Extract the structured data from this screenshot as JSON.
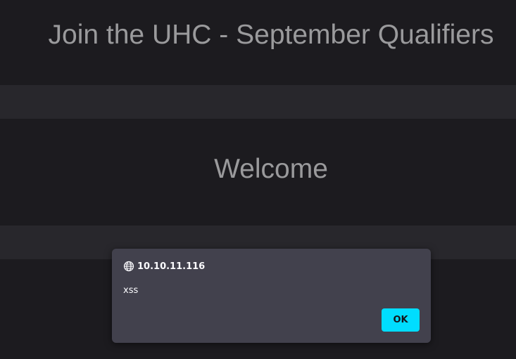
{
  "page": {
    "title": "Join the UHC - September Qualifiers",
    "welcome": "Welcome"
  },
  "dialog": {
    "origin": "10.10.11.116",
    "message": "xss",
    "ok_label": "OK",
    "accent_color": "#00ddff"
  },
  "icons": {
    "origin_icon": "globe-icon"
  }
}
